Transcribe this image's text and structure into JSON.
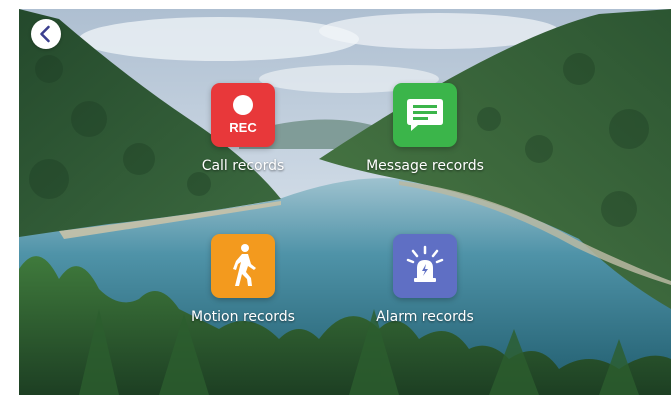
{
  "navigation": {
    "back_icon": "chevron-left-icon"
  },
  "tiles": [
    {
      "label": "Call records",
      "icon": "rec-icon",
      "icon_text": "REC",
      "color": "#e8383a"
    },
    {
      "label": "Message records",
      "icon": "message-icon",
      "color": "#3bb54a"
    },
    {
      "label": "Motion records",
      "icon": "walking-person-icon",
      "color": "#f39a1e"
    },
    {
      "label": "Alarm records",
      "icon": "alarm-siren-icon",
      "color": "#5f6fc4"
    }
  ],
  "background": {
    "scene": "lake-forest-photo",
    "colors": {
      "sky": "#c9d7e4",
      "forest": "#2f5a36",
      "water": "#4f93a8"
    }
  }
}
